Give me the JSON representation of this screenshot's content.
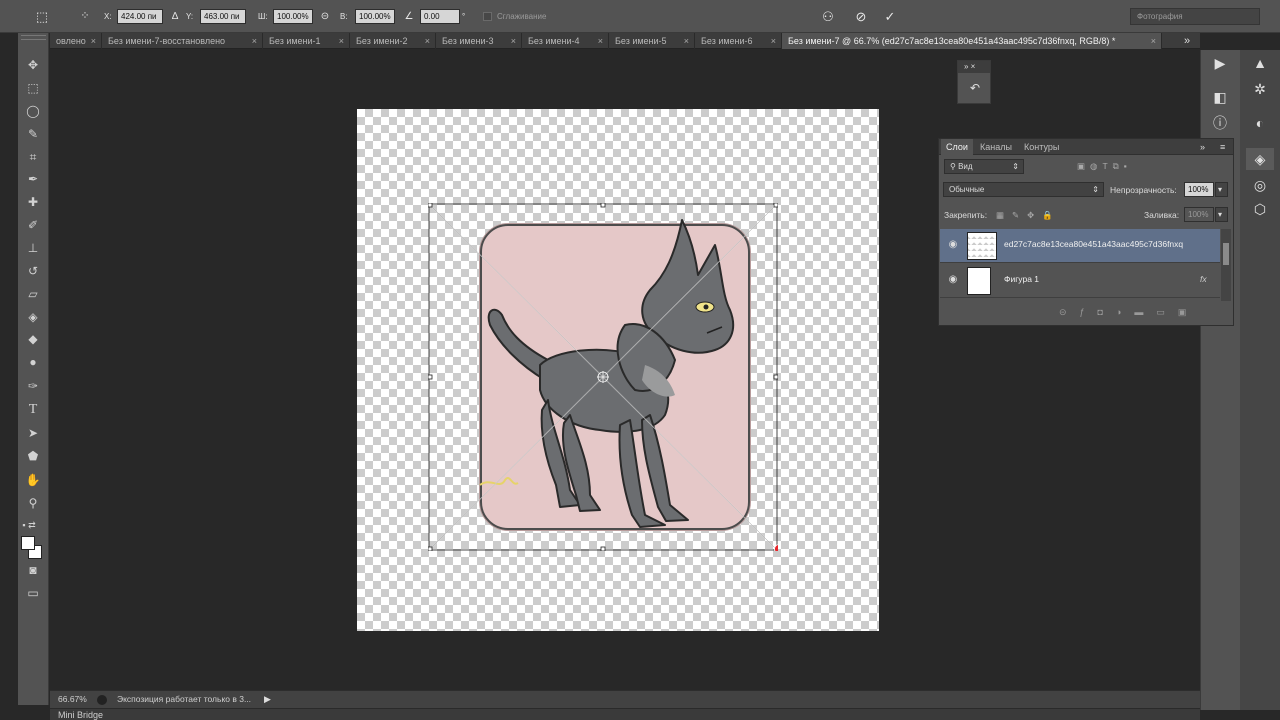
{
  "options": {
    "x_label": "X:",
    "x_value": "424.00 пи",
    "y_label": "Y:",
    "y_value": "463.00 пи",
    "w_label": "Ш:",
    "w_value": "100.00%",
    "h_label": "В:",
    "h_value": "100.00%",
    "angle_value": "0.00",
    "angle_unit": "°",
    "antialias_label": "Сглаживание",
    "workspace": "Фотография"
  },
  "tabs": [
    {
      "label": "овлено"
    },
    {
      "label": "Без имени-7-восстановлено"
    },
    {
      "label": "Без имени-1"
    },
    {
      "label": "Без имени-2"
    },
    {
      "label": "Без имени-3"
    },
    {
      "label": "Без имени-4"
    },
    {
      "label": "Без имени-5"
    },
    {
      "label": "Без имени-6"
    },
    {
      "label": "Без имени-7 @ 66.7% (ed27c7ac8e13cea80e451a43aac495c7d36fnxq, RGB/8) *"
    }
  ],
  "layers_panel": {
    "tabs": [
      "Слои",
      "Каналы",
      "Контуры"
    ],
    "filter_kind": "Вид",
    "blend_mode": "Обычные",
    "opacity_label": "Непрозрачность:",
    "opacity_value": "100%",
    "lock_label": "Закрепить:",
    "fill_label": "Заливка:",
    "fill_value": "100%",
    "layers": [
      {
        "name": "ed27c7ac8e13cea80e451a43aac495c7d36fnxq",
        "selected": true
      },
      {
        "name": "Фигура 1",
        "fx": "fx",
        "selected": false
      }
    ]
  },
  "status": {
    "zoom": "66.67%",
    "message": "Экспозиция работает только в 3..."
  },
  "mini_bridge": "Mini Bridge",
  "colors": {
    "selected_layer": "#60708a",
    "transform_handle": "#e8262b",
    "artwork_bg": "#e5c8c8"
  }
}
